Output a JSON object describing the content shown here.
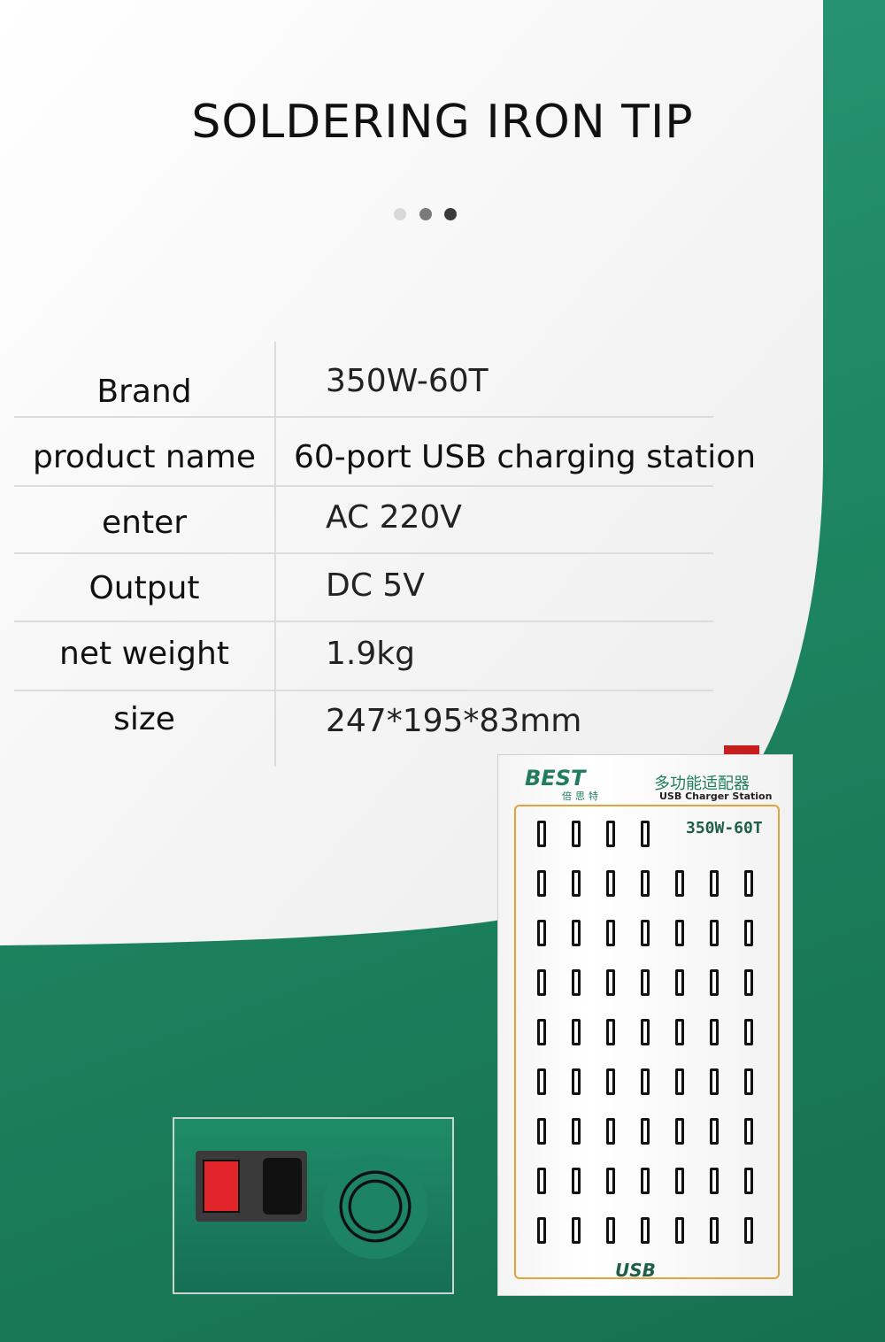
{
  "page": {
    "title": "SOLDERING IRON TIP",
    "carousel_dots": [
      "#d9d9d9",
      "#7a7a7a",
      "#3a3a3a"
    ]
  },
  "specs": [
    {
      "label": "Brand",
      "value": "350W-60T"
    },
    {
      "label": "product name",
      "value": "60-port USB charging station"
    },
    {
      "label": "enter",
      "value": "AC 220V"
    },
    {
      "label": "Output",
      "value": "DC 5V"
    },
    {
      "label": "net weight",
      "value": "1.9kg"
    },
    {
      "label": "size",
      "value": "247*195*83mm"
    }
  ],
  "product": {
    "logo": "BEST",
    "logo_cn": "倍思特",
    "name_cn": "多功能适配器",
    "name_en": "USB Charger Station",
    "model": "350W-60T",
    "usb_mark": "USB"
  },
  "colors": {
    "brand_green": "#1f8a66",
    "panel": "#f7f7f7",
    "accent_orange": "#e3a23b"
  }
}
